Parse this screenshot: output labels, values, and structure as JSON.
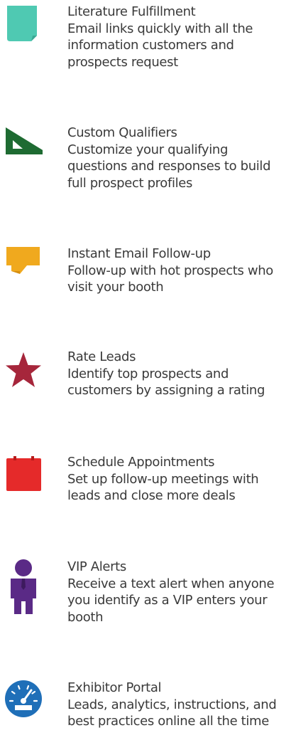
{
  "features": [
    {
      "title": "Literature Fulfillment",
      "description": "Email links quickly with all the information customers and prospects request",
      "icon": "brochure-icon",
      "color": "#4fc9b2"
    },
    {
      "title": "Custom Qualifiers",
      "description": "Customize your qualifying questions and responses to build full prospect profiles",
      "icon": "set-square-icon",
      "color": "#1e6b32"
    },
    {
      "title": "Instant Email Follow-up",
      "description": "Follow-up with hot prospects who visit your booth",
      "icon": "chat-bubble-icon",
      "color": "#f0a91e"
    },
    {
      "title": "Rate Leads",
      "description": "Identify top prospects and customers by assigning a rating",
      "icon": "star-icon",
      "color": "#a6263b"
    },
    {
      "title": "Schedule Appointments",
      "description": "Set up follow-up meetings with leads and close more deals",
      "icon": "calendar-icon",
      "color": "#e52a2a"
    },
    {
      "title": "VIP Alerts",
      "description": "Receive a text alert when anyone you identify as a VIP enters your booth",
      "icon": "person-icon",
      "color": "#5a2a86"
    },
    {
      "title": "Exhibitor Portal",
      "description": "Leads, analytics, instructions, and best practices online all the time",
      "icon": "speedometer-icon",
      "color": "#1f6fb8"
    }
  ]
}
